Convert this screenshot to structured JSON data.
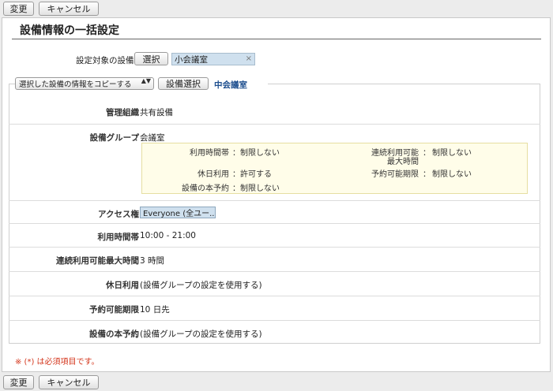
{
  "toolbar": {
    "change_label": "変更",
    "cancel_label": "キャンセル"
  },
  "page_title": "設備情報の一括設定",
  "target": {
    "label": "設定対象の設備",
    "required_mark": "(*)",
    "sep": "：",
    "select_label": "選択",
    "chip_value": "小会議室",
    "chip_remove": "×"
  },
  "copy": {
    "select_value": "選択した設備の情報をコピーする",
    "select_arrows": "▲▼",
    "button_label": "設備選択",
    "selected_name": "中会議室"
  },
  "rows": {
    "org": {
      "label": "管理組織",
      "value": "共有設備"
    },
    "group": {
      "label": "設備グループ",
      "value": "会議室"
    },
    "access": {
      "label": "アクセス権",
      "value": "Everyone (全ユー..."
    },
    "hours": {
      "label": "利用時間帯",
      "value": "10:00 - 21:00"
    },
    "maxtime": {
      "label": "連続利用可能最大時間",
      "value": "3 時間"
    },
    "holiday": {
      "label": "休日利用",
      "value": "(設備グループの設定を使用する)"
    },
    "period": {
      "label": "予約可能期限",
      "value": "10 日先"
    },
    "tentative": {
      "label": "設備の本予約",
      "value": "(設備グループの設定を使用する)"
    }
  },
  "group_details": {
    "hours_label": "利用時間帯",
    "hours_value": "制限しない",
    "max_label_1": "連続利用可能",
    "max_label_2": "最大時間",
    "max_value": "制限しない",
    "holiday_label": "休日利用",
    "holiday_value": "許可する",
    "period_label": "予約可能期限",
    "period_value": "制限しない",
    "tentative_label": "設備の本予約",
    "tentative_value": "制限しない"
  },
  "sep": "：",
  "required_note": "※ (*) は必須項目です。"
}
